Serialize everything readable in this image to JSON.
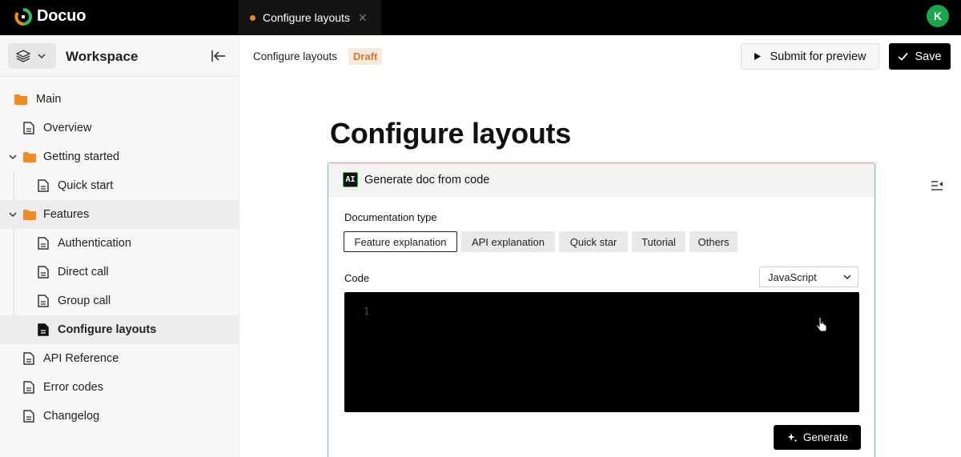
{
  "app": {
    "name": "Docuo",
    "avatar_initial": "K"
  },
  "tabs": [
    {
      "label": "Configure layouts",
      "unsaved": true
    }
  ],
  "sidebar": {
    "workspace_title": "Workspace",
    "items": [
      {
        "label": "Main",
        "icon": "folder-icon",
        "level": 0
      },
      {
        "label": "Overview",
        "icon": "document-icon",
        "level": 1
      },
      {
        "label": "Getting started",
        "icon": "folder-icon",
        "level": 0,
        "expanded": true
      },
      {
        "label": "Quick start",
        "icon": "document-icon",
        "level": 2
      },
      {
        "label": "Features",
        "icon": "folder-icon",
        "level": 0,
        "expanded": true
      },
      {
        "label": "Authentication",
        "icon": "document-icon",
        "level": 2
      },
      {
        "label": "Direct call",
        "icon": "document-icon",
        "level": 2
      },
      {
        "label": "Group call",
        "icon": "document-icon",
        "level": 2
      },
      {
        "label": "Configure layouts",
        "icon": "document-icon",
        "level": 2,
        "active": true
      },
      {
        "label": "API Reference",
        "icon": "document-icon",
        "level": 1
      },
      {
        "label": "Error codes",
        "icon": "document-icon",
        "level": 1
      },
      {
        "label": "Changelog",
        "icon": "document-icon",
        "level": 1
      }
    ]
  },
  "header": {
    "doc_title": "Configure layouts",
    "status_badge": "Draft",
    "submit_label": "Submit for preview",
    "save_label": "Save"
  },
  "main": {
    "page_title": "Configure layouts",
    "generator": {
      "badge": "AI",
      "title": "Generate doc from code",
      "doc_type_label": "Documentation type",
      "doc_types": [
        {
          "label": "Feature explanation",
          "selected": true
        },
        {
          "label": "API explanation",
          "selected": false
        },
        {
          "label": "Quick star",
          "selected": false
        },
        {
          "label": "Tutorial",
          "selected": false
        },
        {
          "label": "Others",
          "selected": false
        }
      ],
      "code_label": "Code",
      "language": "JavaScript",
      "line_number": "1",
      "generate_label": "Generate"
    }
  },
  "colors": {
    "accent_orange": "#f08a24",
    "card_border": "#63c98d",
    "avatar_green": "#1aa64a",
    "draft_text": "#d9772b"
  }
}
